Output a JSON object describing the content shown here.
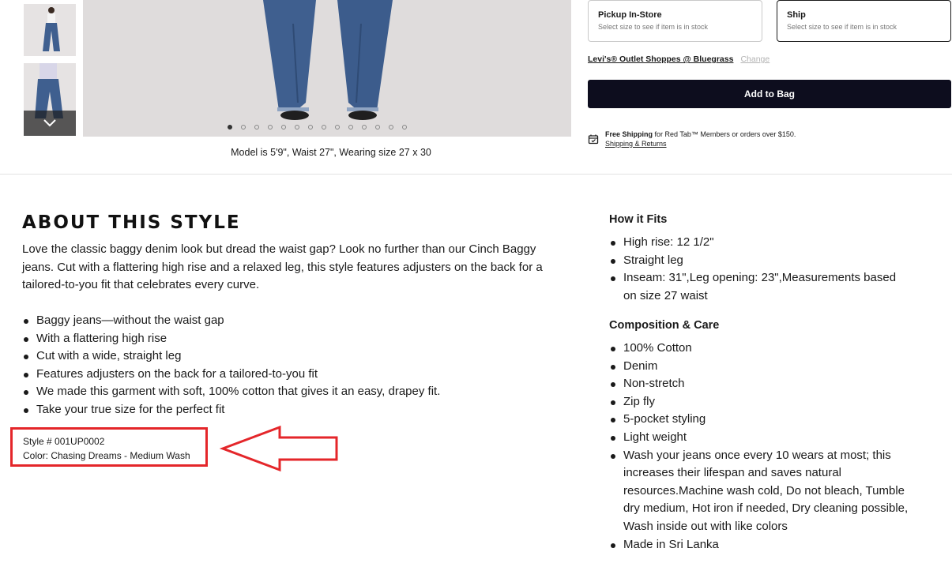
{
  "gallery": {
    "thumbnails": [
      "model-front-thumbnail",
      "model-side-thumbnail"
    ],
    "scroll_icon": "chevron-down-icon",
    "dot_count": 14,
    "active_dot": 0,
    "model_caption": "Model is 5'9\", Waist 27\", Wearing size 27 x 30"
  },
  "fulfillment": {
    "pickup": {
      "title": "Pickup In-Store",
      "subtitle": "Select size to see if item is in stock"
    },
    "ship": {
      "title": "Ship",
      "subtitle": "Select size to see if item is in stock",
      "selected": true
    },
    "store_name": "Levi's® Outlet Shoppes @ Bluegrass",
    "change_label": "Change",
    "add_to_bag_label": "Add to Bag",
    "shipping_bold": "Free Shipping",
    "shipping_text": " for Red Tab™ Members or orders over $150.",
    "shipping_link": "Shipping & Returns"
  },
  "about": {
    "title": "ABOUT THIS STYLE",
    "description": "Love the classic baggy denim look but dread the waist gap? Look no further than our Cinch Baggy jeans. Cut with a flattering high rise and a relaxed leg, this style features adjusters on the back for a tailored-to-you fit that celebrates every curve.",
    "bullets": [
      "Baggy jeans—without the waist gap",
      "With a flattering high rise",
      "Cut with a wide, straight leg",
      "Features adjusters on the back for a tailored-to-you fit",
      "We made this garment with soft, 100% cotton that gives it an easy, drapey fit.",
      "Take your true size for the perfect fit"
    ],
    "style_number": "Style # 001UP0002",
    "color": "Color: Chasing Dreams - Medium Wash"
  },
  "how_it_fits": {
    "title": "How it Fits",
    "items": [
      "High rise: 12 1/2\"",
      "Straight leg",
      "Inseam: 31\",Leg opening: 23\",Measurements based on size 27 waist"
    ]
  },
  "composition": {
    "title": "Composition & Care",
    "items": [
      "100% Cotton",
      "Denim",
      "Non-stretch",
      "Zip fly",
      "5-pocket styling",
      "Light weight",
      "Wash your jeans once every 10 wears at most; this increases their lifespan and saves natural resources.Machine wash cold, Do not bleach, Tumble dry medium, Hot iron if needed, Dry cleaning possible, Wash inside out with like colors",
      "Made in Sri Lanka"
    ]
  },
  "colors": {
    "annotation_red": "#e4262a",
    "button_dark": "#0d0d1e",
    "denim": "#3f5f8f"
  }
}
